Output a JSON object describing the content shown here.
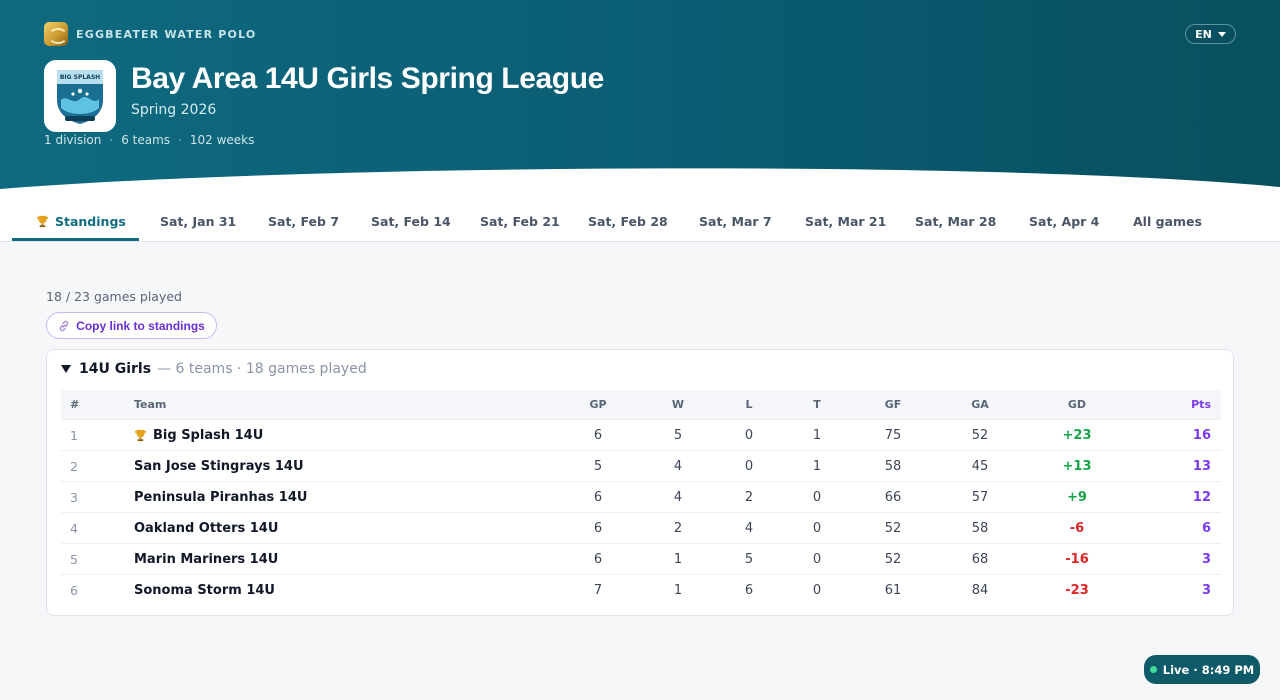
{
  "brand": {
    "name": "EGGBEATER WATER POLO"
  },
  "language": {
    "current": "EN"
  },
  "league": {
    "logo_text": "BIG SPLASH",
    "title": "Bay Area 14U Girls Spring League",
    "season": "Spring 2026",
    "meta": [
      "1 division",
      "6 teams",
      "102 weeks"
    ]
  },
  "tabs": [
    {
      "label": "Standings",
      "active": true
    },
    {
      "label": "Sat, Jan 31"
    },
    {
      "label": "Sat, Feb 7"
    },
    {
      "label": "Sat, Feb 14"
    },
    {
      "label": "Sat, Feb 21"
    },
    {
      "label": "Sat, Feb 28"
    },
    {
      "label": "Sat, Mar 7"
    },
    {
      "label": "Sat, Mar 21"
    },
    {
      "label": "Sat, Mar 28"
    },
    {
      "label": "Sat, Apr 4"
    },
    {
      "label": "All games"
    }
  ],
  "summary": {
    "games_played": "18 / 23 games played"
  },
  "copy_link": {
    "label": "Copy link to standings"
  },
  "division": {
    "name": "14U Girls",
    "meta": "— 6 teams · 18 games played",
    "columns": [
      "#",
      "Team",
      "GP",
      "W",
      "L",
      "T",
      "GF",
      "GA",
      "GD",
      "Pts"
    ],
    "rows": [
      {
        "rank": "1",
        "team": "Big Splash 14U",
        "leader": true,
        "gp": "6",
        "w": "5",
        "l": "0",
        "t": "1",
        "gf": "75",
        "ga": "52",
        "gd": "+23",
        "pts": "16"
      },
      {
        "rank": "2",
        "team": "San Jose Stingrays 14U",
        "gp": "5",
        "w": "4",
        "l": "0",
        "t": "1",
        "gf": "58",
        "ga": "45",
        "gd": "+13",
        "pts": "13"
      },
      {
        "rank": "3",
        "team": "Peninsula Piranhas 14U",
        "gp": "6",
        "w": "4",
        "l": "2",
        "t": "0",
        "gf": "66",
        "ga": "57",
        "gd": "+9",
        "pts": "12"
      },
      {
        "rank": "4",
        "team": "Oakland Otters 14U",
        "gp": "6",
        "w": "2",
        "l": "4",
        "t": "0",
        "gf": "52",
        "ga": "58",
        "gd": "-6",
        "pts": "6"
      },
      {
        "rank": "5",
        "team": "Marin Mariners 14U",
        "gp": "6",
        "w": "1",
        "l": "5",
        "t": "0",
        "gf": "52",
        "ga": "68",
        "gd": "-16",
        "pts": "3"
      },
      {
        "rank": "6",
        "team": "Sonoma Storm 14U",
        "gp": "7",
        "w": "1",
        "l": "6",
        "t": "0",
        "gf": "61",
        "ga": "84",
        "gd": "-23",
        "pts": "3"
      }
    ]
  },
  "live": {
    "label": "Live · 8:49 PM"
  },
  "colors": {
    "header": "#0e6a80",
    "accent": "#7c3aed",
    "positive": "#16a34a",
    "negative": "#dc2626"
  }
}
